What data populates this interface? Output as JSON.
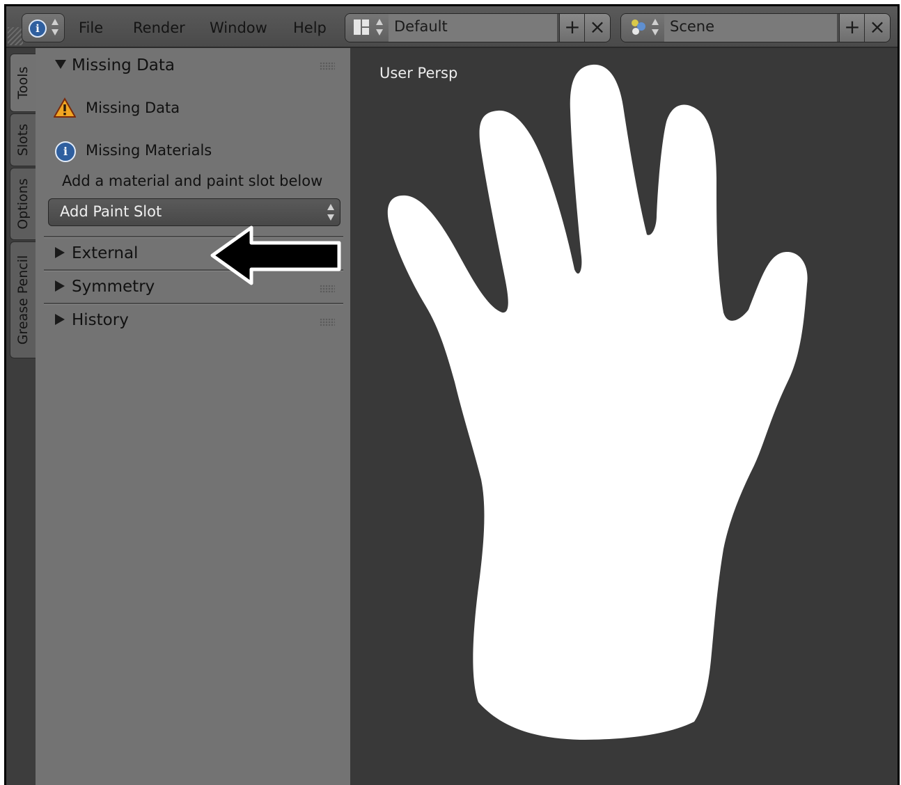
{
  "header": {
    "menu": [
      "File",
      "Render",
      "Window",
      "Help"
    ],
    "layout_name": "Default",
    "scene_name": "Scene"
  },
  "tabs": [
    "Tools",
    "Slots",
    "Options",
    "Grease Pencil"
  ],
  "panel": {
    "missing_data_header": "Missing Data",
    "missing_data_warning": "Missing Data",
    "missing_materials": "Missing Materials",
    "hint": "Add a material and paint slot below",
    "add_paint_slot": "Add Paint Slot",
    "sections": [
      "External",
      "Symmetry",
      "History"
    ]
  },
  "viewport": {
    "label": "User Persp"
  },
  "colors": {
    "panel_bg": "#737373",
    "viewport_bg": "#393939",
    "header_bg": "#4a4a4a",
    "hand_fill": "#ffffff"
  }
}
